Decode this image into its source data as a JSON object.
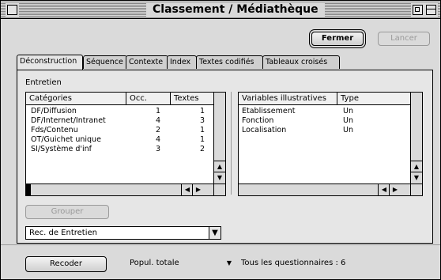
{
  "window": {
    "title": "Classement / Médiathèque"
  },
  "buttons": {
    "close": "Fermer",
    "launch": "Lancer",
    "group": "Grouper",
    "recode": "Recoder"
  },
  "tabs": [
    {
      "label": "Déconstruction"
    },
    {
      "label": "Séquence"
    },
    {
      "label": "Contexte"
    },
    {
      "label": "Index"
    },
    {
      "label": "Textes codifiés"
    },
    {
      "label": "Tableaux croisés"
    }
  ],
  "panel": {
    "section_label": "Entretien",
    "categories": {
      "headers": [
        "Catégories",
        "Occ.",
        "Textes"
      ],
      "rows": [
        {
          "name": "DF/Diffusion",
          "occ": "1",
          "textes": "1"
        },
        {
          "name": "DF/Internet/Intranet",
          "occ": "4",
          "textes": "3"
        },
        {
          "name": "Fds/Contenu",
          "occ": "2",
          "textes": "1"
        },
        {
          "name": "OT/Guichet unique",
          "occ": "4",
          "textes": "1"
        },
        {
          "name": "SI/Système d'inf",
          "occ": "3",
          "textes": "2"
        }
      ]
    },
    "variables": {
      "headers": [
        "Variables illustratives",
        "Type"
      ],
      "rows": [
        {
          "name": "Etablissement",
          "type": "Un"
        },
        {
          "name": "Fonction",
          "type": "Un"
        },
        {
          "name": "Localisation",
          "type": "Un"
        }
      ]
    },
    "rec_select": {
      "value": "Rec. de Entretien"
    }
  },
  "footer": {
    "population_select": "Popul. totale",
    "status": "Tous les questionnaires : 6"
  }
}
